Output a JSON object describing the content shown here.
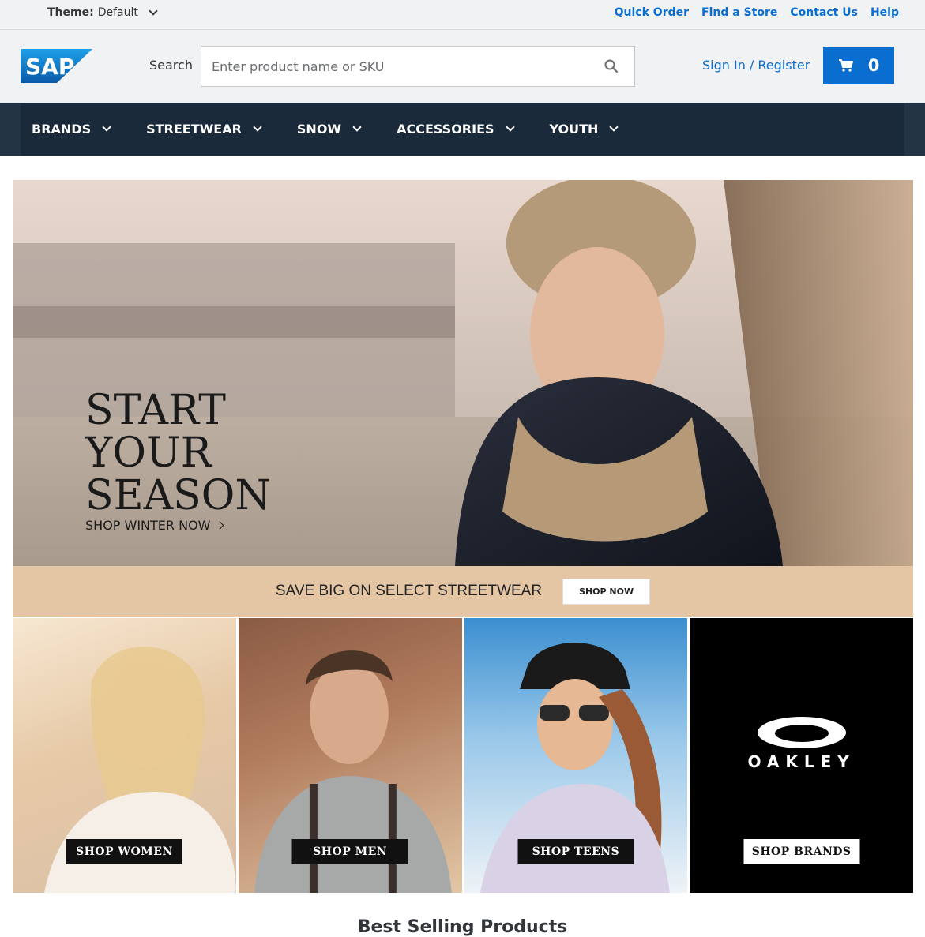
{
  "topbar": {
    "theme_label": "Theme:",
    "theme_value": "Default",
    "links": [
      "Quick Order",
      "Find a Store",
      "Contact Us",
      "Help"
    ]
  },
  "header": {
    "logo_text": "SAP",
    "search_label": "Search",
    "search_placeholder": "Enter product name or SKU",
    "signin": "Sign In / Register",
    "cart_count": "0"
  },
  "nav": {
    "items": [
      "BRANDS",
      "STREETWEAR",
      "SNOW",
      "ACCESSORIES",
      "YOUTH"
    ]
  },
  "hero": {
    "line1": "START",
    "line2": "YOUR",
    "line3": "SEASON",
    "cta": "SHOP WINTER NOW"
  },
  "promo": {
    "text": "SAVE BIG ON SELECT STREETWEAR",
    "button": "SHOP NOW"
  },
  "tiles": [
    {
      "label": "SHOP WOMEN"
    },
    {
      "label": "SHOP MEN"
    },
    {
      "label": "SHOP TEENS"
    },
    {
      "label": "SHOP BRANDS",
      "brand": "OAKLEY"
    }
  ],
  "section_title": "Best Selling Products",
  "colors": {
    "accent": "#0a6ed1",
    "nav_bg": "#1b2a3a",
    "promo_bg": "#e5c6a4"
  }
}
